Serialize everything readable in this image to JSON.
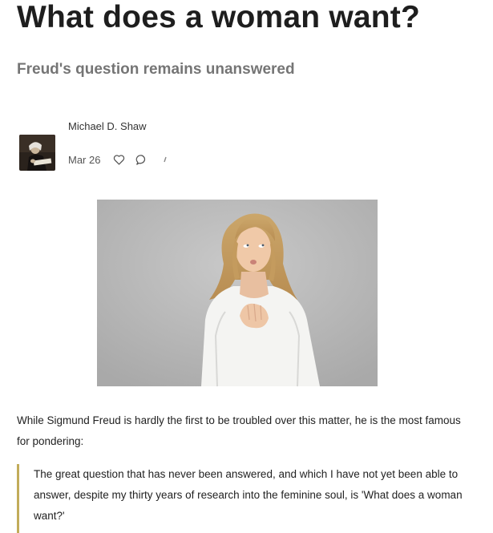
{
  "article": {
    "title": "What does a woman want?",
    "subtitle": "Freud's question remains unanswered",
    "author": {
      "name": "Michael D. Shaw",
      "avatar_icon": "author-photo"
    },
    "meta": {
      "date": "Mar 26",
      "like_icon": "heart-icon",
      "comment_icon": "comment-icon",
      "share_icon": "share-icon"
    },
    "hero_image": {
      "icon": "photo-woman-thinking"
    },
    "paragraph": "While Sigmund Freud is hardly the first to be troubled over this matter, he is the most famous for pondering:",
    "blockquote": "The great question that has never been answered, and which I have not yet been able to answer, despite my thirty years of research into the feminine soul, is 'What does a woman want?'",
    "colors": {
      "quote_border": "#c2ac5a",
      "subtitle": "#757575",
      "title": "#1e1e1e"
    }
  }
}
